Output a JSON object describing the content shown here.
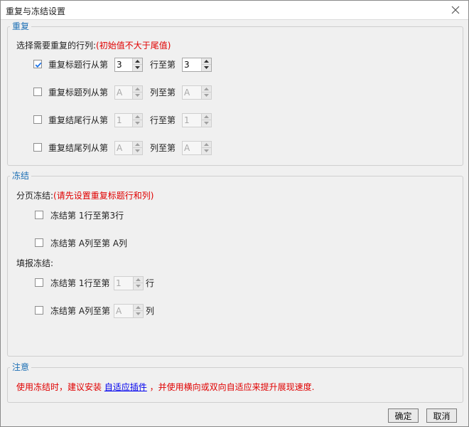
{
  "window": {
    "title": "重复与冻结设置"
  },
  "repeat": {
    "legend": "重复",
    "intro": "选择需要重复的行列:",
    "intro_note": "(初始值不大于尾值)",
    "rows": [
      {
        "label": "重复标题行从第",
        "checked": true,
        "from": "3",
        "mid": "行至第",
        "to": "3",
        "enabled": true
      },
      {
        "label": "重复标题列从第",
        "checked": false,
        "from": "A",
        "mid": "列至第",
        "to": "A",
        "enabled": false
      },
      {
        "label": "重复结尾行从第",
        "checked": false,
        "from": "1",
        "mid": "行至第",
        "to": "1",
        "enabled": false
      },
      {
        "label": "重复结尾列从第",
        "checked": false,
        "from": "A",
        "mid": "列至第",
        "to": "A",
        "enabled": false
      }
    ]
  },
  "freeze": {
    "legend": "冻结",
    "page_label": "分页冻结:",
    "page_note": "(请先设置重复标题行和列)",
    "page_rows": [
      {
        "text": "冻结第 1行至第3行",
        "checked": false
      },
      {
        "text": "冻结第 A列至第 A列",
        "checked": false
      }
    ],
    "fill_label": "填报冻结:",
    "fill_rows": [
      {
        "prefix": "冻结第 1行至第",
        "value": "1",
        "suffix": "行",
        "checked": false
      },
      {
        "prefix": "冻结第 A列至第",
        "value": "A",
        "suffix": "列",
        "checked": false
      }
    ]
  },
  "note": {
    "legend": "注意",
    "text_before": "使用冻结时，建议安装 ",
    "link": "自适应插件",
    "text_after": " ，并使用横向或双向自适应来提升展现速度."
  },
  "buttons": {
    "ok": "确定",
    "cancel": "取消"
  },
  "colors": {
    "legend": "#1c6fb5",
    "warning": "#e00000",
    "link": "#0000ee",
    "check": "#1a73e8"
  }
}
